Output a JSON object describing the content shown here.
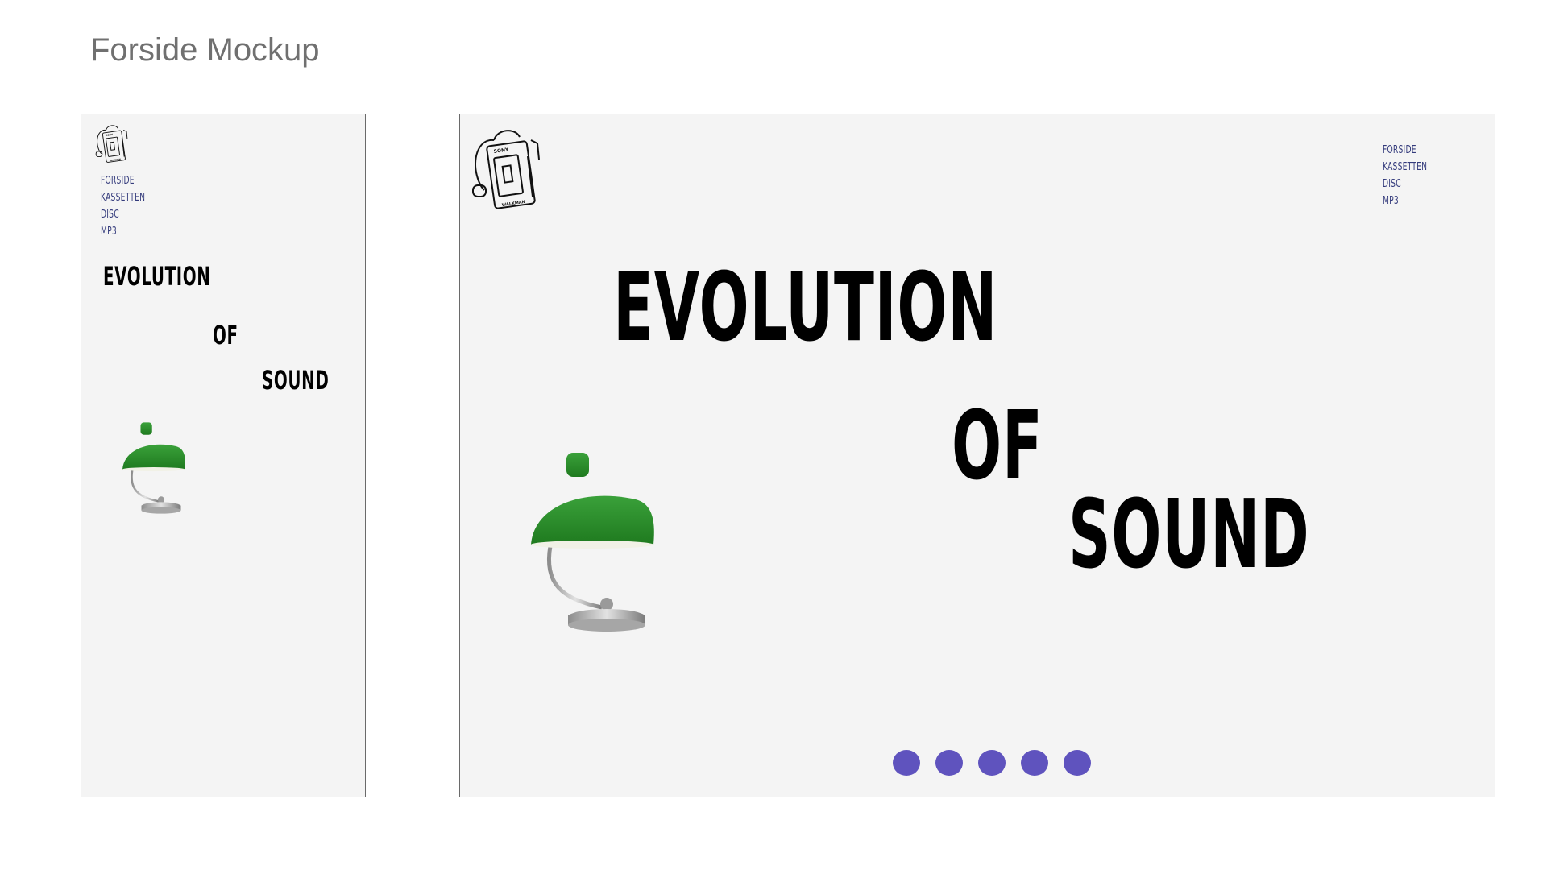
{
  "slide": {
    "title": "Forside Mockup"
  },
  "nav": {
    "items": [
      {
        "label": "FORSIDE"
      },
      {
        "label": "KASSETTEN"
      },
      {
        "label": "DISC"
      },
      {
        "label": "MP3"
      }
    ]
  },
  "hero": {
    "line1": "EVOLUTION",
    "line2": "OF",
    "line3": "SOUND"
  },
  "logo": {
    "icon": "walkman-icon",
    "brand": "SONY",
    "model": "WALKMAN"
  },
  "lamp": {
    "icon": "desk-lamp-image"
  },
  "carousel": {
    "count": 5
  },
  "colors": {
    "nav_text": "#343b7c",
    "dot": "#5f53be",
    "lamp_shade": "#2a8a2a",
    "frame_bg": "#f4f4f4"
  }
}
